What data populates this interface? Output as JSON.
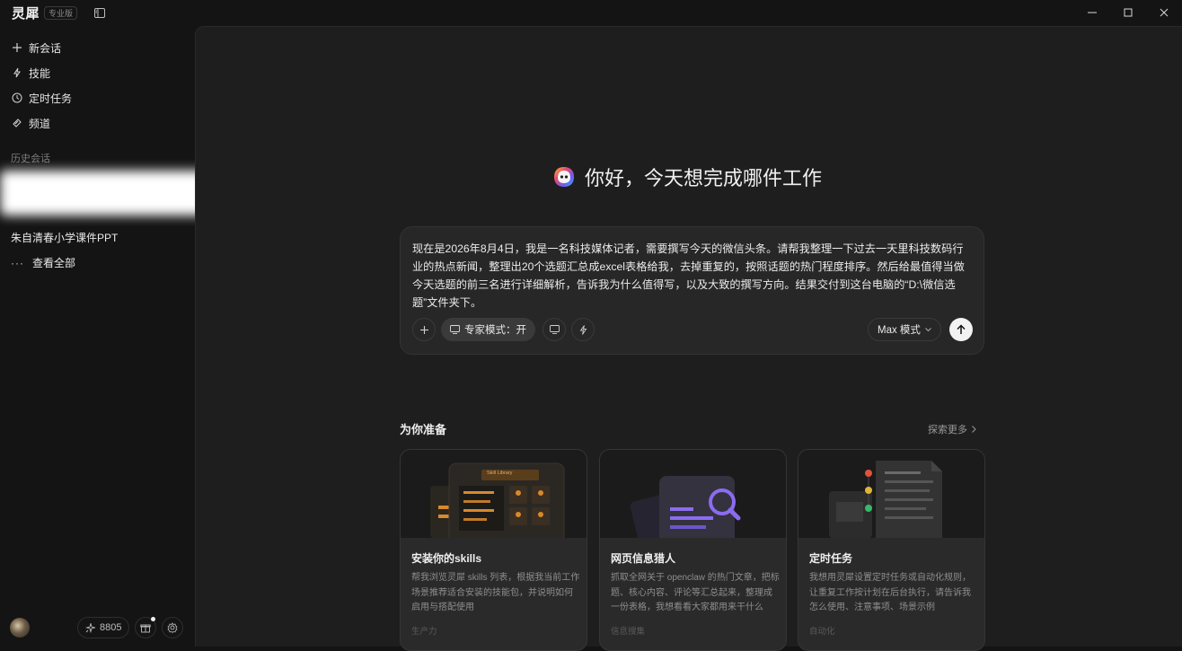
{
  "app": {
    "name": "灵犀",
    "edition": "专业版"
  },
  "sidebar": {
    "nav": [
      {
        "label": "新会话",
        "icon": "plus-icon"
      },
      {
        "label": "技能",
        "icon": "lightning-icon"
      },
      {
        "label": "定时任务",
        "icon": "clock-icon"
      },
      {
        "label": "频道",
        "icon": "channel-icon"
      }
    ],
    "history_label": "历史会话",
    "history": [
      "朱自清春小学课件PPT"
    ],
    "view_all": "查看全部",
    "credits": "8805"
  },
  "main": {
    "greeting": "你好，今天想完成哪件工作",
    "composer": {
      "text": "现在是2026年8月4日，我是一名科技媒体记者，需要撰写今天的微信头条。请帮我整理一下过去一天里科技数码行业的热点新闻，整理出20个选题汇总成excel表格给我，去掉重复的，按照话题的热门程度排序。然后给最值得当做今天选题的前三名进行详细解析，告诉我为什么值得写，以及大致的撰写方向。结果交付到这台电脑的“D:\\微信选题”文件夹下。",
      "expert_mode": "专家模式：开",
      "max_mode": "Max 模式"
    },
    "prepared_title": "为你准备",
    "explore_more": "探索更多",
    "cards": [
      {
        "title": "安装你的skills",
        "desc": "帮我浏览灵犀 skills 列表，根据我当前工作场景推荐适合安装的技能包，并说明如何启用与搭配使用",
        "tag": "生产力",
        "illus_label": "Skill Library"
      },
      {
        "title": "网页信息猎人",
        "desc": "抓取全网关于 openclaw 的热门文章，把标题、核心内容、评论等汇总起来，整理成一份表格，我想看看大家都用来干什么",
        "tag": "信息搜集"
      },
      {
        "title": "定时任务",
        "desc": "我想用灵犀设置定时任务或自动化规则，让重复工作按计划在后台执行，请告诉我怎么使用、注意事项、场景示例",
        "tag": "自动化"
      }
    ]
  },
  "colors": {
    "background": "#141414",
    "main": "#1e1e1e",
    "card": "#2a2a2a",
    "accent_purple": "#8b6cf0",
    "accent_orange": "#d9892b"
  }
}
